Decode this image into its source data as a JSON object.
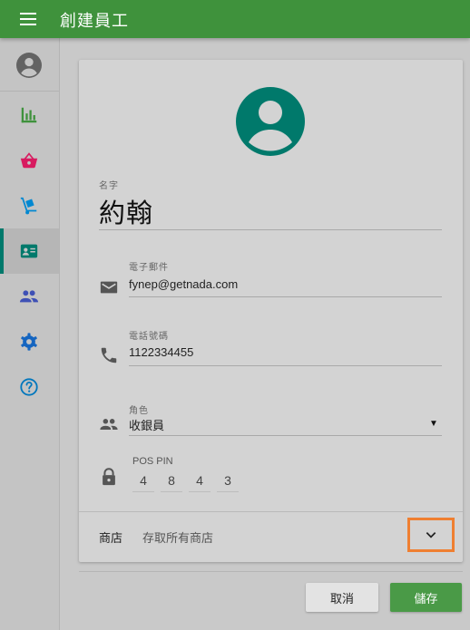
{
  "app": {
    "title": "創建員工"
  },
  "colors": {
    "appbar": "#3f923c",
    "accent": "#00796b",
    "save": "#4a9a47",
    "highlight": "#ef7f31"
  },
  "sidebar": {
    "items": [
      {
        "icon": "bar-chart-icon",
        "color": "#3f923c"
      },
      {
        "icon": "basket-icon",
        "color": "#d81b60"
      },
      {
        "icon": "hand-truck-icon",
        "color": "#0288d1"
      },
      {
        "icon": "badge-icon",
        "color": "#00796b",
        "active": true
      },
      {
        "icon": "people-icon",
        "color": "#3f51b5"
      },
      {
        "icon": "gear-icon",
        "color": "#1565c0"
      },
      {
        "icon": "help-icon",
        "color": "#0277bd"
      }
    ]
  },
  "form": {
    "name": {
      "label": "名字",
      "value": "約翰"
    },
    "email": {
      "label": "電子郵件",
      "value": "fynep@getnada.com"
    },
    "phone": {
      "label": "電話號碼",
      "value": "1122334455"
    },
    "role": {
      "label": "角色",
      "value": "收銀員"
    },
    "pin": {
      "label": "POS PIN",
      "digits": [
        "4",
        "8",
        "4",
        "3"
      ]
    },
    "store": {
      "label": "商店",
      "value": "存取所有商店"
    }
  },
  "actions": {
    "cancel": "取消",
    "save": "儲存"
  }
}
